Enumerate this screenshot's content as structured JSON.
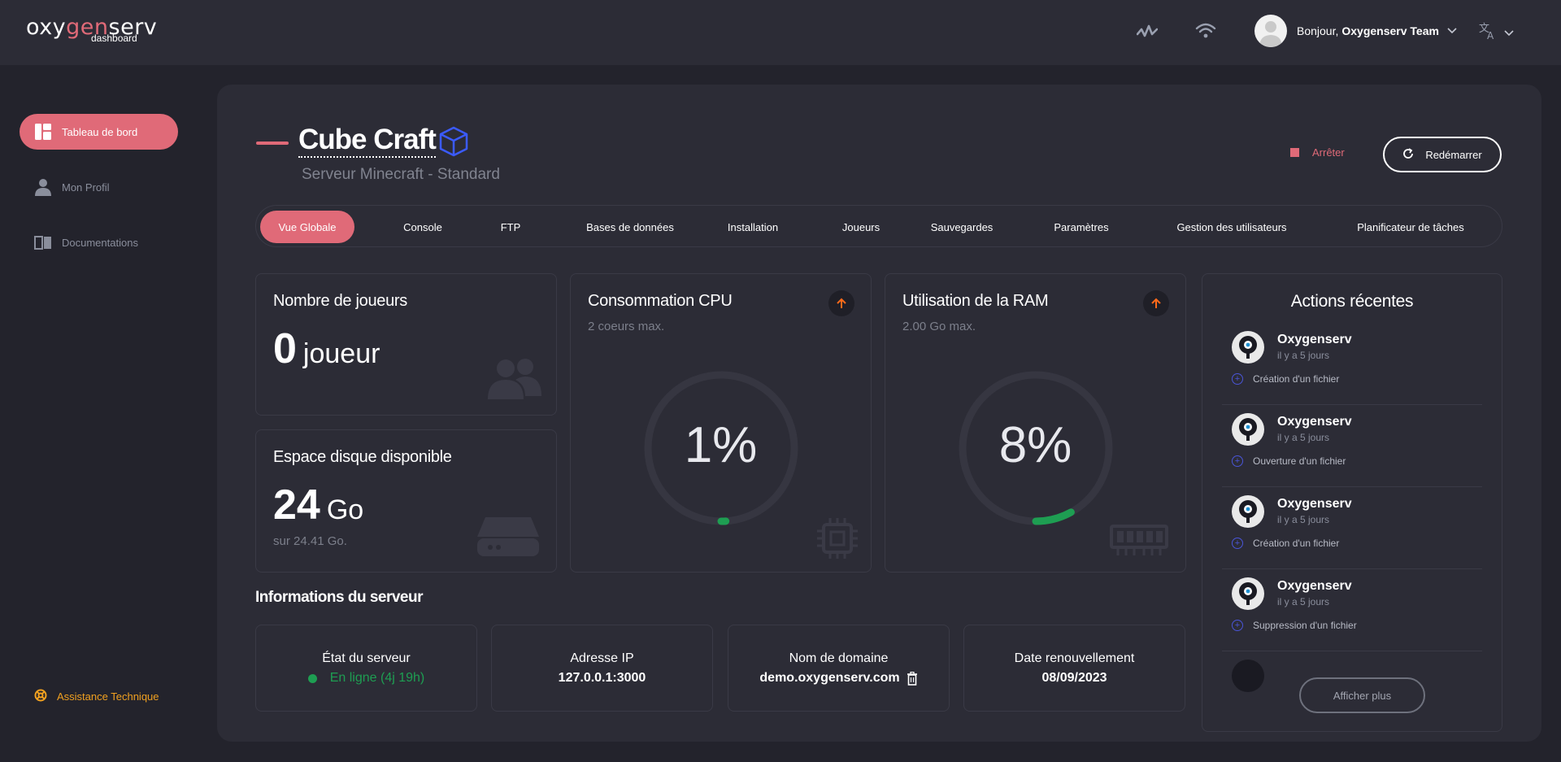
{
  "brand": {
    "logo_left": "oxy",
    "logo_accent": "gen",
    "logo_right": "serv",
    "logo_sub": "dashboard"
  },
  "header": {
    "greeting": "Bonjour,",
    "user_name": "Oxygenserv Team"
  },
  "sidebar": {
    "items": [
      {
        "label": "Tableau de bord",
        "icon": "dashboard-icon",
        "active": true
      },
      {
        "label": "Mon Profil",
        "icon": "user-icon",
        "active": false
      },
      {
        "label": "Documentations",
        "icon": "book-icon",
        "active": false
      }
    ],
    "assistance": "Assistance Technique"
  },
  "server": {
    "name": "Cube Craft",
    "subtitle": "Serveur Minecraft - Standard"
  },
  "controls": {
    "stop_label": "Arrêter",
    "restart_label": "Redémarrer"
  },
  "tabs": [
    "Vue Globale",
    "Console",
    "FTP",
    "Bases de données",
    "Installation",
    "Joueurs",
    "Sauvegardes",
    "Paramètres",
    "Gestion des utilisateurs",
    "Planificateur de tâches"
  ],
  "cards": {
    "players": {
      "title": "Nombre de joueurs",
      "value": "0",
      "unit": "joueur"
    },
    "disk": {
      "title": "Espace disque disponible",
      "value": "24",
      "unit": "Go",
      "note": "sur 24.41 Go."
    },
    "cpu": {
      "title": "Consommation CPU",
      "sub": "2 coeurs max.",
      "value": "1%",
      "percent": 1
    },
    "ram": {
      "title": "Utilisation de la RAM",
      "sub": "2.00 Go max.",
      "value": "8%",
      "percent": 8
    }
  },
  "info": {
    "title": "Informations du serveur",
    "state_label": "État du serveur",
    "state_value": "En ligne (4j 19h)",
    "ip_label": "Adresse IP",
    "ip_value": "127.0.0.1:3000",
    "domain_label": "Nom de domaine",
    "domain_value": "demo.oxygenserv.com",
    "renew_label": "Date renouvellement",
    "renew_value": "08/09/2023"
  },
  "actions": {
    "title": "Actions récentes",
    "items": [
      {
        "name": "Oxygenserv",
        "time": "il y a 5 jours",
        "desc": "Création d'un fichier"
      },
      {
        "name": "Oxygenserv",
        "time": "il y a 5 jours",
        "desc": "Ouverture d'un fichier"
      },
      {
        "name": "Oxygenserv",
        "time": "il y a 5 jours",
        "desc": "Création d'un fichier"
      },
      {
        "name": "Oxygenserv",
        "time": "il y a 5 jours",
        "desc": "Suppression d'un fichier"
      }
    ],
    "more_label": "Afficher plus"
  },
  "colors": {
    "accent": "#e06a78",
    "online": "#1e9e52",
    "arrow": "#ff6a1a",
    "warning": "#f0a020"
  }
}
